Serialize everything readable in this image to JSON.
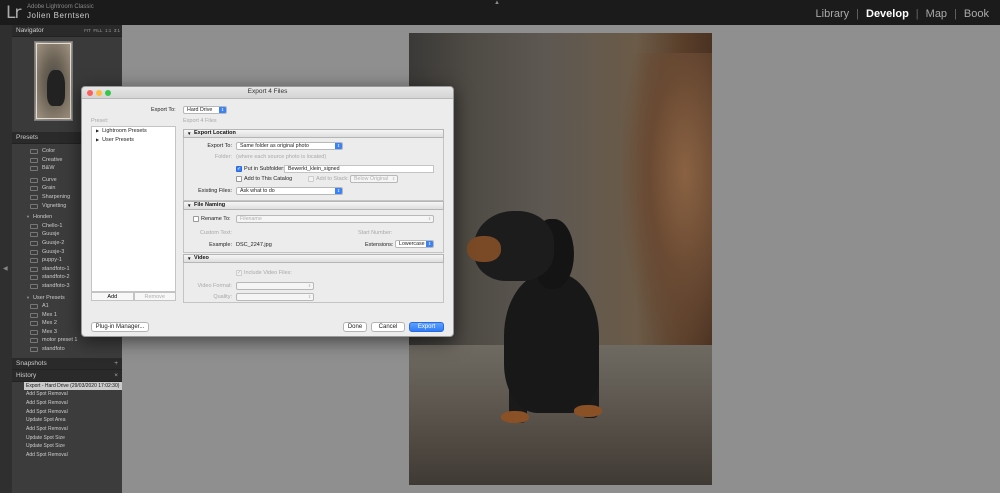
{
  "app": {
    "logo": "Lr",
    "product": "Adobe Lightroom Classic",
    "user": "Jolien Berntsen",
    "modules": [
      "Library",
      "Develop",
      "Map",
      "Book"
    ],
    "active_module": "Develop",
    "separator": "|"
  },
  "left_panel": {
    "navigator": {
      "title": "Navigator",
      "zoom_options": [
        "FIT",
        "FILL",
        "1:1",
        "3:1"
      ]
    },
    "presets": {
      "title": "Presets",
      "groups": [
        {
          "name": "",
          "items": [
            "Color",
            "Creative",
            "B&W"
          ]
        },
        {
          "name": "",
          "items": [
            "Curve",
            "Grain",
            "Sharpening",
            "Vignetting"
          ]
        },
        {
          "name": "Honden",
          "items": [
            "Chello-1",
            "Guusje",
            "Guusje-2",
            "Guusje-3",
            "puppy-1",
            "standfoto-1",
            "standfoto-2",
            "standfoto-3"
          ]
        },
        {
          "name": "User Presets",
          "items": [
            "A1",
            "Mex 1",
            "Mex 2",
            "Mex 3",
            "motor preset 1",
            "standfoto"
          ]
        }
      ]
    },
    "snapshots": {
      "title": "Snapshots",
      "add": "+"
    },
    "history": {
      "title": "History",
      "close": "×",
      "items": [
        "Export - Hard Drive (29/03/2020 17:02:30)",
        "Add Spot Removal",
        "Add Spot Removal",
        "Add Spot Removal",
        "Update Spot Area",
        "Add Spot Removal",
        "Update Spot Size",
        "Update Spot Size",
        "Add Spot Removal"
      ]
    }
  },
  "dialog": {
    "title": "Export 4 Files",
    "export_to_label": "Export To:",
    "export_to_value": "Hard Drive",
    "preset_label": "Preset:",
    "subtitle": "Export 4 Files",
    "presets": [
      "Lightroom Presets",
      "User Presets"
    ],
    "add_label": "Add",
    "remove_label": "Remove",
    "export_location": {
      "title": "Export Location",
      "export_to_label": "Export To:",
      "export_to_value": "Same folder as original photo",
      "folder_label": "Folder:",
      "folder_value": "(where each source photo is located)",
      "put_in_subfolder_label": "Put in Subfolder:",
      "put_in_subfolder_checked": true,
      "subfolder_value": "Bewerkt_klein_signed",
      "add_to_catalog_label": "Add to This Catalog",
      "add_to_catalog_checked": false,
      "add_to_stack_label": "Add to Stack:",
      "below_original_label": "Below Original",
      "existing_files_label": "Existing Files:",
      "existing_files_value": "Ask what to do"
    },
    "file_naming": {
      "title": "File Naming",
      "rename_to_label": "Rename To:",
      "rename_to_checked": false,
      "rename_to_value": "Filename",
      "custom_text_label": "Custom Text:",
      "start_number_label": "Start Number:",
      "example_label": "Example:",
      "example_value": "DSC_2247.jpg",
      "extensions_label": "Extensions:",
      "extensions_value": "Lowercase"
    },
    "video": {
      "title": "Video",
      "include_label": "Include Video Files:",
      "format_label": "Video Format:",
      "quality_label": "Quality:"
    },
    "plugin_manager_label": "Plug-in Manager...",
    "done_label": "Done",
    "cancel_label": "Cancel",
    "export_label": "Export"
  },
  "colors": {
    "accent": "#3b82f6",
    "dark_bg": "#1b1b1b",
    "panel_bg": "#3c3c3c",
    "canvas_bg": "#8f8f8f"
  }
}
